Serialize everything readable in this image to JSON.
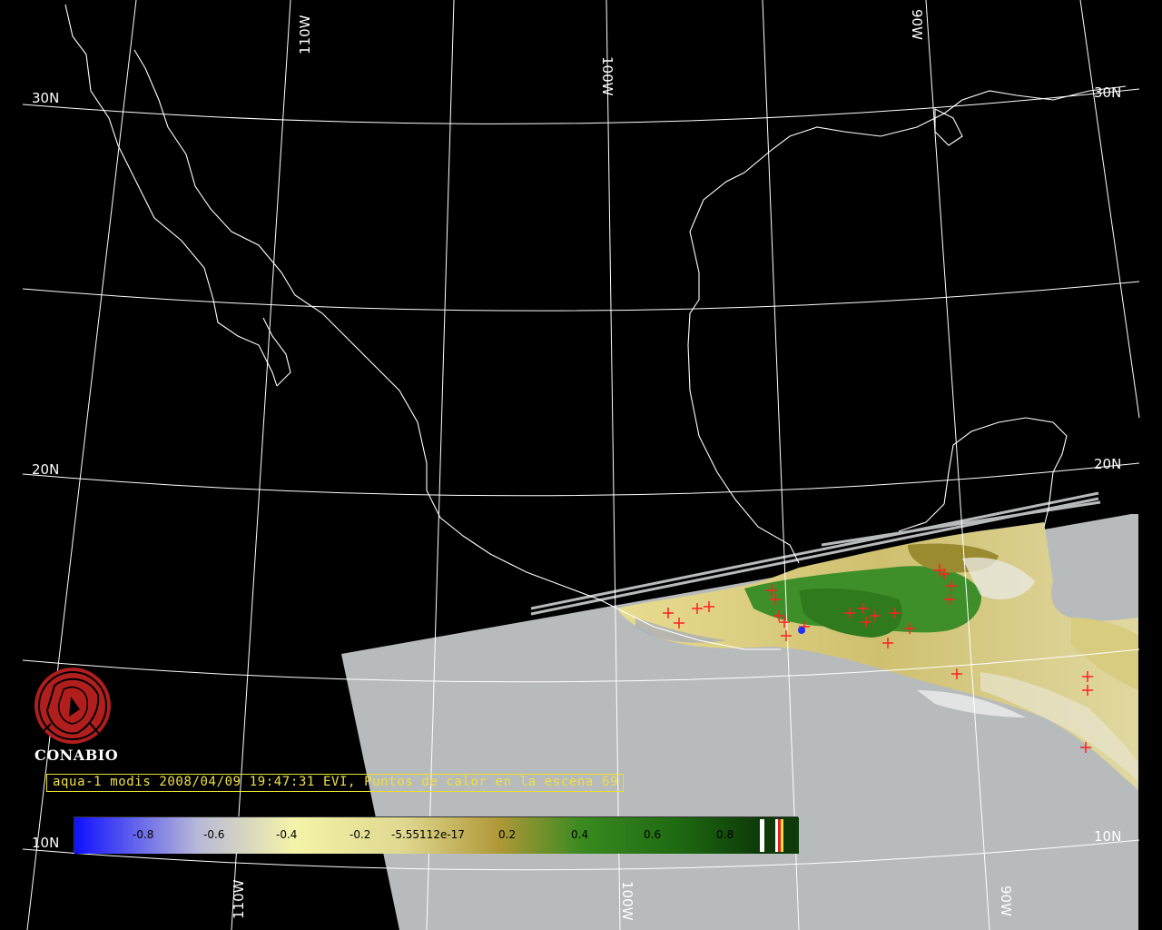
{
  "map": {
    "grid_labels": {
      "lat_left": [
        "30N",
        "20N",
        "10N"
      ],
      "lat_right": [
        "30N",
        "20N",
        "10N"
      ],
      "lon_top": [
        "110W",
        "100W",
        "90W"
      ],
      "lon_bottom": [
        "110W",
        "100W",
        "90W"
      ]
    },
    "logo": {
      "name": "CONABIO"
    },
    "caption": "aqua-1 modis 2008/04/09 19:47:31 EVI, Puntos de calor en la escena 69",
    "colorbar": {
      "ticks": [
        "-0.8",
        "-0.6",
        "-0.4",
        "-0.2",
        "-5.55112e-17",
        "0.2",
        "0.4",
        "0.6",
        "0.8"
      ],
      "colors": {
        "low": "#1a1aff",
        "mid_low": "#c8c8d8",
        "neutral": "#f0f0a0",
        "mid": "#b8a040",
        "high": "#2a8a1a",
        "max": "#0a3a0a"
      }
    },
    "scene_background_color": "#b8bbbc",
    "fire_marker_color": "#ff2020",
    "coastline_color": "#ffffff"
  }
}
